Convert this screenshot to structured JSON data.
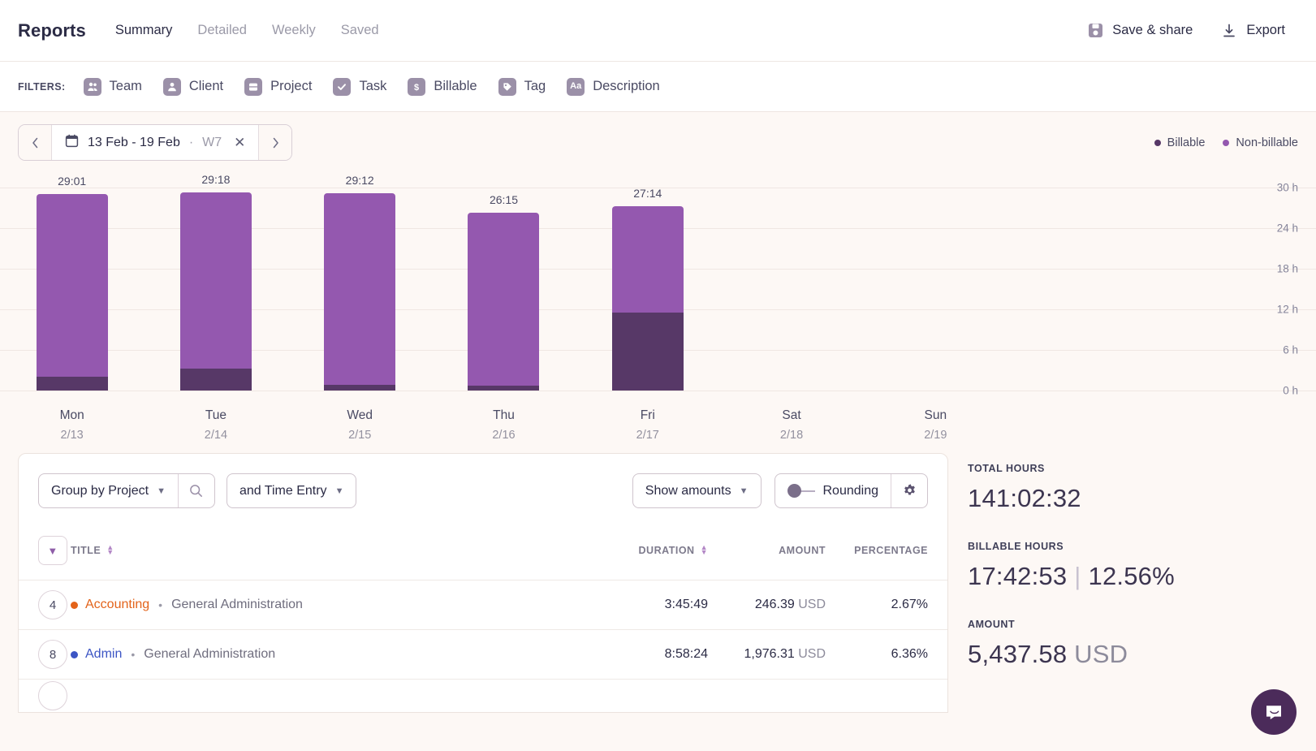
{
  "header": {
    "title": "Reports",
    "tabs": [
      {
        "label": "Summary",
        "active": true
      },
      {
        "label": "Detailed",
        "active": false
      },
      {
        "label": "Weekly",
        "active": false
      },
      {
        "label": "Saved",
        "active": false
      }
    ],
    "save_share_label": "Save & share",
    "export_label": "Export"
  },
  "filters": {
    "label": "FILTERS:",
    "items": [
      {
        "label": "Team",
        "icon": "team-icon"
      },
      {
        "label": "Client",
        "icon": "client-icon"
      },
      {
        "label": "Project",
        "icon": "project-icon"
      },
      {
        "label": "Task",
        "icon": "task-check-icon"
      },
      {
        "label": "Billable",
        "icon": "billable-dollar-icon"
      },
      {
        "label": "Tag",
        "icon": "tag-icon"
      },
      {
        "label": "Description",
        "icon": "description-aa-icon"
      }
    ]
  },
  "daterange": {
    "prev_icon": "chevron-left-icon",
    "next_icon": "chevron-right-icon",
    "calendar_icon": "calendar-icon",
    "text": "13 Feb - 19 Feb",
    "separator": "·",
    "week": "W7",
    "clear_icon": "close-icon"
  },
  "legend": [
    {
      "label": "Billable",
      "color": "#573867"
    },
    {
      "label": "Non-billable",
      "color": "#9458af"
    }
  ],
  "chart_data": {
    "type": "bar",
    "stacked": true,
    "title": "",
    "xlabel": "",
    "ylabel": "",
    "ylim": [
      0,
      30
    ],
    "grid": true,
    "yticks": [
      "0 h",
      "6 h",
      "12 h",
      "18 h",
      "24 h",
      "30 h"
    ],
    "ytick_values": [
      0,
      6,
      12,
      18,
      24,
      30
    ],
    "categories": [
      "Mon",
      "Tue",
      "Wed",
      "Thu",
      "Fri",
      "Sat",
      "Sun"
    ],
    "dates": [
      "2/13",
      "2/14",
      "2/15",
      "2/16",
      "2/17",
      "2/18",
      "2/19"
    ],
    "totals_label": [
      "29:01",
      "29:18",
      "29:12",
      "26:15",
      "27:14",
      "",
      ""
    ],
    "totals": [
      29.02,
      29.3,
      29.2,
      26.25,
      27.23,
      0,
      0
    ],
    "series": [
      {
        "name": "Billable",
        "color": "#573867",
        "values": [
          2.1,
          3.3,
          0.8,
          0.7,
          11.5,
          0,
          0
        ]
      },
      {
        "name": "Non-billable",
        "color": "#9458af",
        "values": [
          26.92,
          26.0,
          28.4,
          25.55,
          15.73,
          0,
          0
        ]
      }
    ]
  },
  "table_controls": {
    "group_by": "Group by Project",
    "search_icon": "search-icon",
    "and_group": "and Time Entry",
    "show_amounts": "Show amounts",
    "rounding": "Rounding",
    "settings_icon": "gear-icon"
  },
  "table": {
    "columns": [
      "TITLE",
      "DURATION",
      "AMOUNT",
      "PERCENTAGE"
    ],
    "rows": [
      {
        "count": "4",
        "project": "Accounting",
        "project_color": "#e3631a",
        "client": "General Administration",
        "duration": "3:45:49",
        "amount": "246.39",
        "currency": "USD",
        "percentage": "2.67%"
      },
      {
        "count": "8",
        "project": "Admin",
        "project_color": "#3c55c4",
        "client": "General Administration",
        "duration": "8:58:24",
        "amount": "1,976.31",
        "currency": "USD",
        "percentage": "6.36%"
      }
    ]
  },
  "summary": {
    "total_hours_label": "TOTAL HOURS",
    "total_hours_value": "141:02:32",
    "billable_hours_label": "BILLABLE HOURS",
    "billable_hours_value": "17:42:53",
    "billable_hours_percent": "12.56%",
    "amount_label": "AMOUNT",
    "amount_value": "5,437.58",
    "amount_currency": "USD"
  }
}
